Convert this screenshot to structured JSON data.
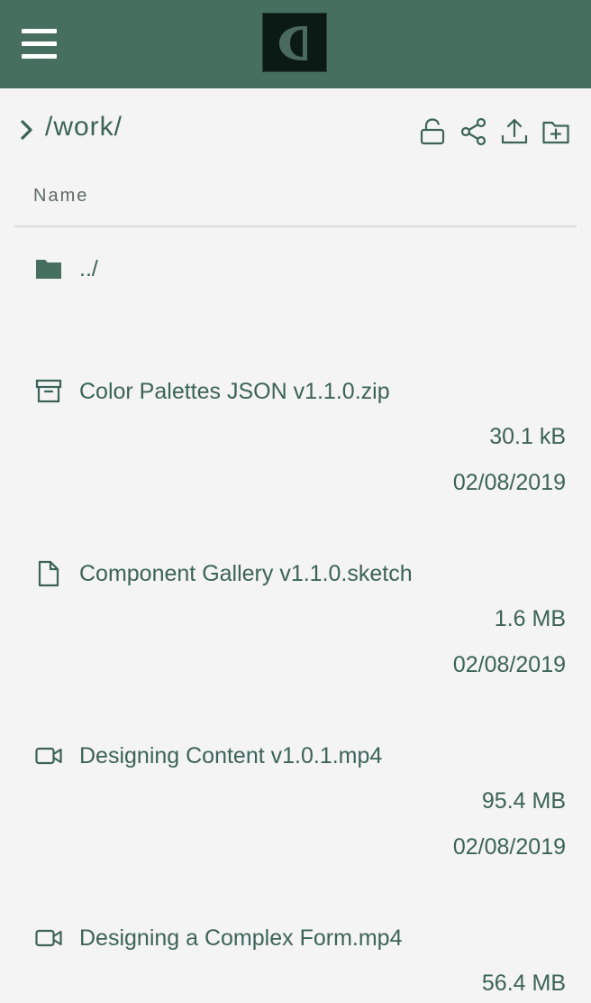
{
  "header": {
    "menu_icon": "hamburger-menu-icon",
    "logo_letter": "C"
  },
  "path": {
    "text": "/work/",
    "expand_icon": "chevron-right-icon"
  },
  "actions": [
    {
      "name": "unlock-icon"
    },
    {
      "name": "share-icon"
    },
    {
      "name": "upload-icon"
    },
    {
      "name": "new-folder-icon"
    }
  ],
  "table": {
    "column_name": "Name"
  },
  "files": [
    {
      "name": "../",
      "icon": "folder-icon",
      "size": "",
      "date": ""
    },
    {
      "name": "Color Palettes JSON v1.1.0.zip",
      "icon": "archive-icon",
      "size": "30.1 kB",
      "date": "02/08/2019"
    },
    {
      "name": "Component Gallery v1.1.0.sketch",
      "icon": "document-icon",
      "size": "1.6 MB",
      "date": "02/08/2019"
    },
    {
      "name": "Designing Content v1.0.1.mp4",
      "icon": "video-icon",
      "size": "95.4 MB",
      "date": "02/08/2019"
    },
    {
      "name": "Designing a Complex Form.mp4",
      "icon": "video-icon",
      "size": "56.4 MB",
      "date": ""
    }
  ],
  "colors": {
    "topbar": "#476f60",
    "text": "#3c6357",
    "background": "#f4f4f4"
  }
}
